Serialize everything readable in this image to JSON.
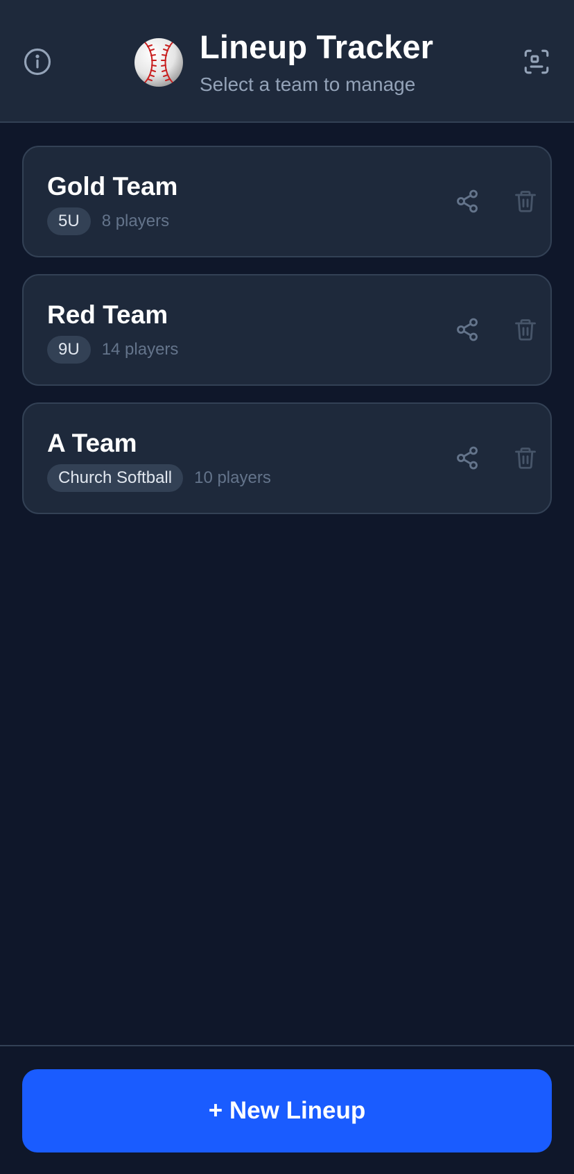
{
  "header": {
    "title": "Lineup Tracker",
    "subtitle": "Select a team to manage",
    "icons": {
      "info": "info-icon",
      "logo": "baseball-icon",
      "scan": "scan-icon"
    }
  },
  "teams": [
    {
      "name": "Gold Team",
      "badge": "5U",
      "players": "8 players"
    },
    {
      "name": "Red Team",
      "badge": "9U",
      "players": "14 players"
    },
    {
      "name": "A Team",
      "badge": "Church Softball",
      "players": "10 players"
    }
  ],
  "footer": {
    "new_lineup_label": "+ New Lineup"
  },
  "colors": {
    "background": "#0f172a",
    "surface": "#1e293b",
    "border": "#334155",
    "accent": "#1a5cff",
    "muted_text": "#94a3b8"
  }
}
